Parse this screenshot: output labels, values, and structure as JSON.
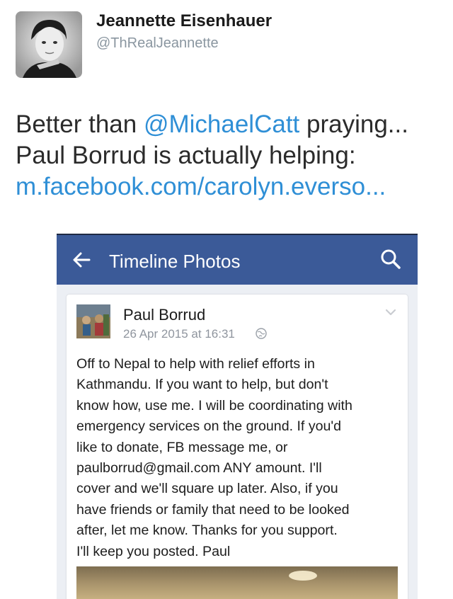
{
  "tweet": {
    "author_name": "Jeannette Eisenhauer",
    "author_handle": "@ThRealJeannette",
    "text_part1": "Better than ",
    "mention": "@MichaelCatt",
    "text_part2": " praying...",
    "text_line2": "Paul Borrud is actually helping:",
    "link": "m.facebook.com/carolyn.everso..."
  },
  "facebook": {
    "bar_title": "Timeline Photos",
    "post": {
      "author": "Paul Borrud",
      "timestamp": "26 Apr 2015 at 16:31",
      "body": "Off to Nepal to help with relief efforts in\nKathmandu.  If you want to help, but don't\nknow how, use me.  I will be coordinating with\nemergency services on the ground.  If you'd\nlike to donate, FB message me, or\npaulborrud@gmail.com ANY amount.  I'll\ncover and we'll square up later.  Also, if you\nhave friends or family that need to be looked\nafter, let me know.  Thanks for you support.\nI'll keep you posted.  Paul"
    }
  },
  "colors": {
    "link_blue": "#2f8fd6",
    "facebook_blue": "#3b5a98",
    "handle_gray": "#8a96a0"
  },
  "icons": [
    "back-arrow-icon",
    "search-icon",
    "globe-icon",
    "chevron-down-icon"
  ]
}
